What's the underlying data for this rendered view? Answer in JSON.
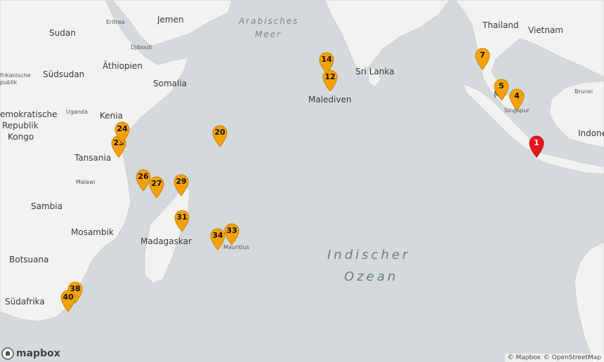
{
  "map": {
    "countries": {
      "sudan": "Sudan",
      "eritrea": "Eritrea",
      "jemen": "Jemen",
      "djibouti": "Djibouti",
      "suedsudan": "Südsudan",
      "aethiopien": "Äthiopien",
      "somalia": "Somalia",
      "zentralafrika_1": "frikanische",
      "zentralafrika_2": "publik",
      "uganda": "Uganda",
      "kenia": "Kenia",
      "kongo_1": "emokratische",
      "kongo_2": "Republik",
      "kongo_3": "Kongo",
      "tansania": "Tansania",
      "malawi": "Malawi",
      "sambia": "Sambia",
      "mosambik": "Mosambik",
      "madagaskar": "Madagaskar",
      "botsuana": "Botsuana",
      "suedafrika": "Südafrika",
      "sri_lanka": "Sri Lanka",
      "malediven": "Malediven",
      "thailand": "Thailand",
      "vietnam": "Vietnam",
      "malaysia_partial": "M",
      "singapur": "Singapur",
      "brunei": "Brunei",
      "indonesien_partial": "Indone",
      "mauritius": "Mauritius"
    },
    "seas": {
      "arabisches_1": "Arabisches",
      "arabisches_2": "Meer",
      "indischer_1": "Indischer",
      "indischer_2": "Ozean"
    },
    "markers": [
      {
        "label": "1",
        "color": "#e8161b"
      },
      {
        "label": "4",
        "color": "#f5a201"
      },
      {
        "label": "5",
        "color": "#f5a201"
      },
      {
        "label": "7",
        "color": "#f5a201"
      },
      {
        "label": "12",
        "color": "#f5a201"
      },
      {
        "label": "14",
        "color": "#f5a201"
      },
      {
        "label": "20",
        "color": "#f5a201"
      },
      {
        "label": "23",
        "color": "#f5a201"
      },
      {
        "label": "24",
        "color": "#f5a201"
      },
      {
        "label": "26",
        "color": "#f5a201"
      },
      {
        "label": "27",
        "color": "#f5a201"
      },
      {
        "label": "29",
        "color": "#f5a201"
      },
      {
        "label": "31",
        "color": "#f5a201"
      },
      {
        "label": "33",
        "color": "#f5a201"
      },
      {
        "label": "34",
        "color": "#f5a201"
      },
      {
        "label": "38",
        "color": "#f5a201"
      },
      {
        "label": "40",
        "color": "#f5a201"
      }
    ],
    "logo": "mapbox",
    "attribution": {
      "mapbox": "© Mapbox",
      "osm": "© OpenStreetMap"
    }
  }
}
